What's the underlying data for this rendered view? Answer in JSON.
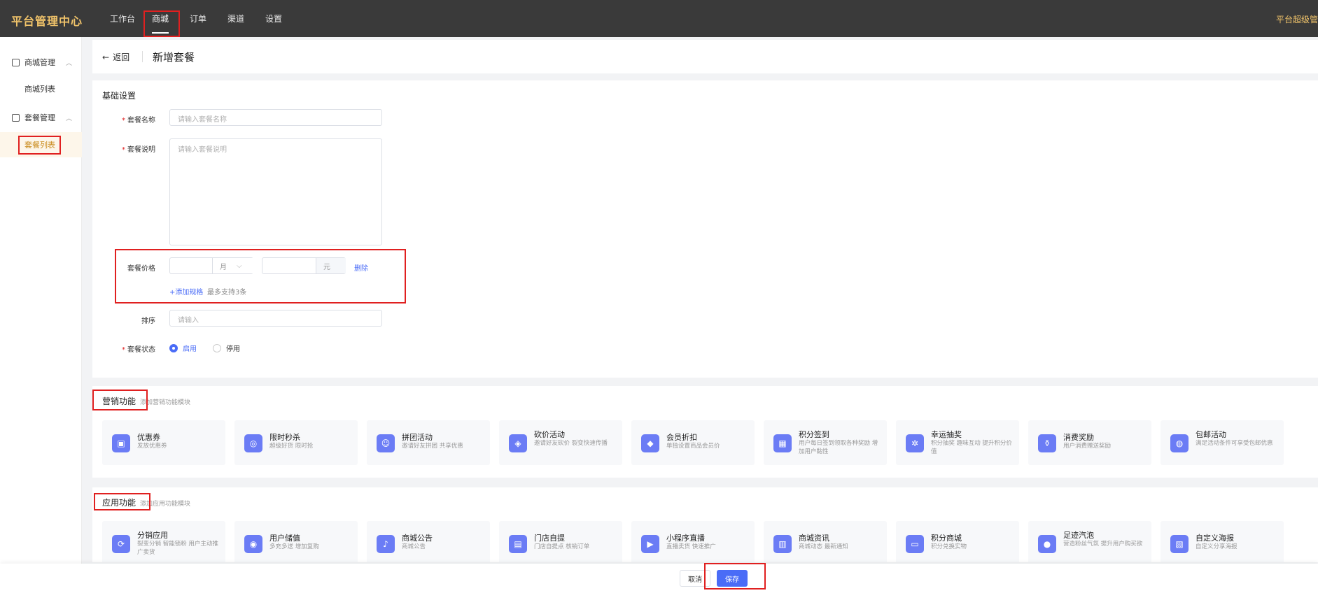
{
  "app": {
    "brand": "平台管理中心",
    "user": "平台超级管理员"
  },
  "nav": [
    {
      "label": "工作台",
      "active": false
    },
    {
      "label": "商城",
      "active": true
    },
    {
      "label": "订单",
      "active": false
    },
    {
      "label": "渠道",
      "active": false
    },
    {
      "label": "设置",
      "active": false
    }
  ],
  "sidebar": {
    "groups": [
      {
        "label": "商城管理",
        "icon": "shop-icon",
        "items": [
          {
            "label": "商城列表",
            "active": false
          }
        ]
      },
      {
        "label": "套餐管理",
        "icon": "clipboard-icon",
        "items": [
          {
            "label": "套餐列表",
            "active": true
          }
        ]
      }
    ]
  },
  "header": {
    "back_label": "返回",
    "title": "新增套餐"
  },
  "basic": {
    "section_title": "基础设置",
    "name_label": "套餐名称",
    "name_placeholder": "请输入套餐名称",
    "desc_label": "套餐说明",
    "desc_placeholder": "请输入套餐说明",
    "price_label": "套餐价格",
    "period_value": "月",
    "price_unit": "元",
    "delete_label": "删除",
    "add_spec_label": "+添加规格",
    "add_spec_hint": "最多支持3条",
    "sort_label": "排序",
    "sort_placeholder": "请输入",
    "status_label": "套餐状态",
    "status_on": "启用",
    "status_off": "停用"
  },
  "marketing": {
    "title": "营销功能",
    "subtitle": "添加营销功能模块",
    "items": [
      {
        "name": "优惠券",
        "desc": "发放优惠券",
        "icon": "ticket-icon"
      },
      {
        "name": "限时秒杀",
        "desc": "超级好货 限时抢",
        "icon": "flash-icon"
      },
      {
        "name": "拼团活动",
        "desc": "邀请好友拼团 共享优惠",
        "icon": "group-icon"
      },
      {
        "name": "砍价活动",
        "desc": "邀请好友砍价 裂变快速传播",
        "icon": "tag-icon"
      },
      {
        "name": "会员折扣",
        "desc": "单独设置商品会员价",
        "icon": "diamond-icon"
      },
      {
        "name": "积分签到",
        "desc": "用户每日签到领取各种奖励 增加用户黏性",
        "icon": "calendar-icon"
      },
      {
        "name": "幸运抽奖",
        "desc": "积分抽奖 趣味互动 提升积分价值",
        "icon": "wheel-icon"
      },
      {
        "name": "消费奖励",
        "desc": "用户消费赠送奖励",
        "icon": "bag-icon"
      },
      {
        "name": "包邮活动",
        "desc": "满足活动条件可享受包邮优惠",
        "icon": "globe-icon"
      }
    ]
  },
  "apps": {
    "title": "应用功能",
    "subtitle": "添加应用功能模块",
    "items": [
      {
        "name": "分销应用",
        "desc": "裂变分销 智能锁粉 用户主动推广卖货",
        "icon": "share-icon"
      },
      {
        "name": "用户储值",
        "desc": "多充多送 增加复购",
        "icon": "wallet-icon"
      },
      {
        "name": "商城公告",
        "desc": "商城公告",
        "icon": "bell-icon"
      },
      {
        "name": "门店自提",
        "desc": "门店自提点 核销订单",
        "icon": "store-icon"
      },
      {
        "name": "小程序直播",
        "desc": "直播卖货 快速推广",
        "icon": "play-icon"
      },
      {
        "name": "商城资讯",
        "desc": "商城动态 最新通知",
        "icon": "news-icon"
      },
      {
        "name": "积分商城",
        "desc": "积分兑换实物",
        "icon": "cart-icon"
      },
      {
        "name": "足迹汽泡",
        "desc": "营造粉丝气氛 提升用户购买欲",
        "icon": "bubble-icon"
      },
      {
        "name": "自定义海报",
        "desc": "自定义分享海报",
        "icon": "poster-icon"
      }
    ]
  },
  "footer": {
    "cancel_label": "取消",
    "save_label": "保存"
  },
  "colors": {
    "topbar": "#3a3a3a",
    "brand": "#f0c36a",
    "primary": "#4a6cf7",
    "icon_bg": "#6b7cf5",
    "highlight": "#e02020"
  }
}
